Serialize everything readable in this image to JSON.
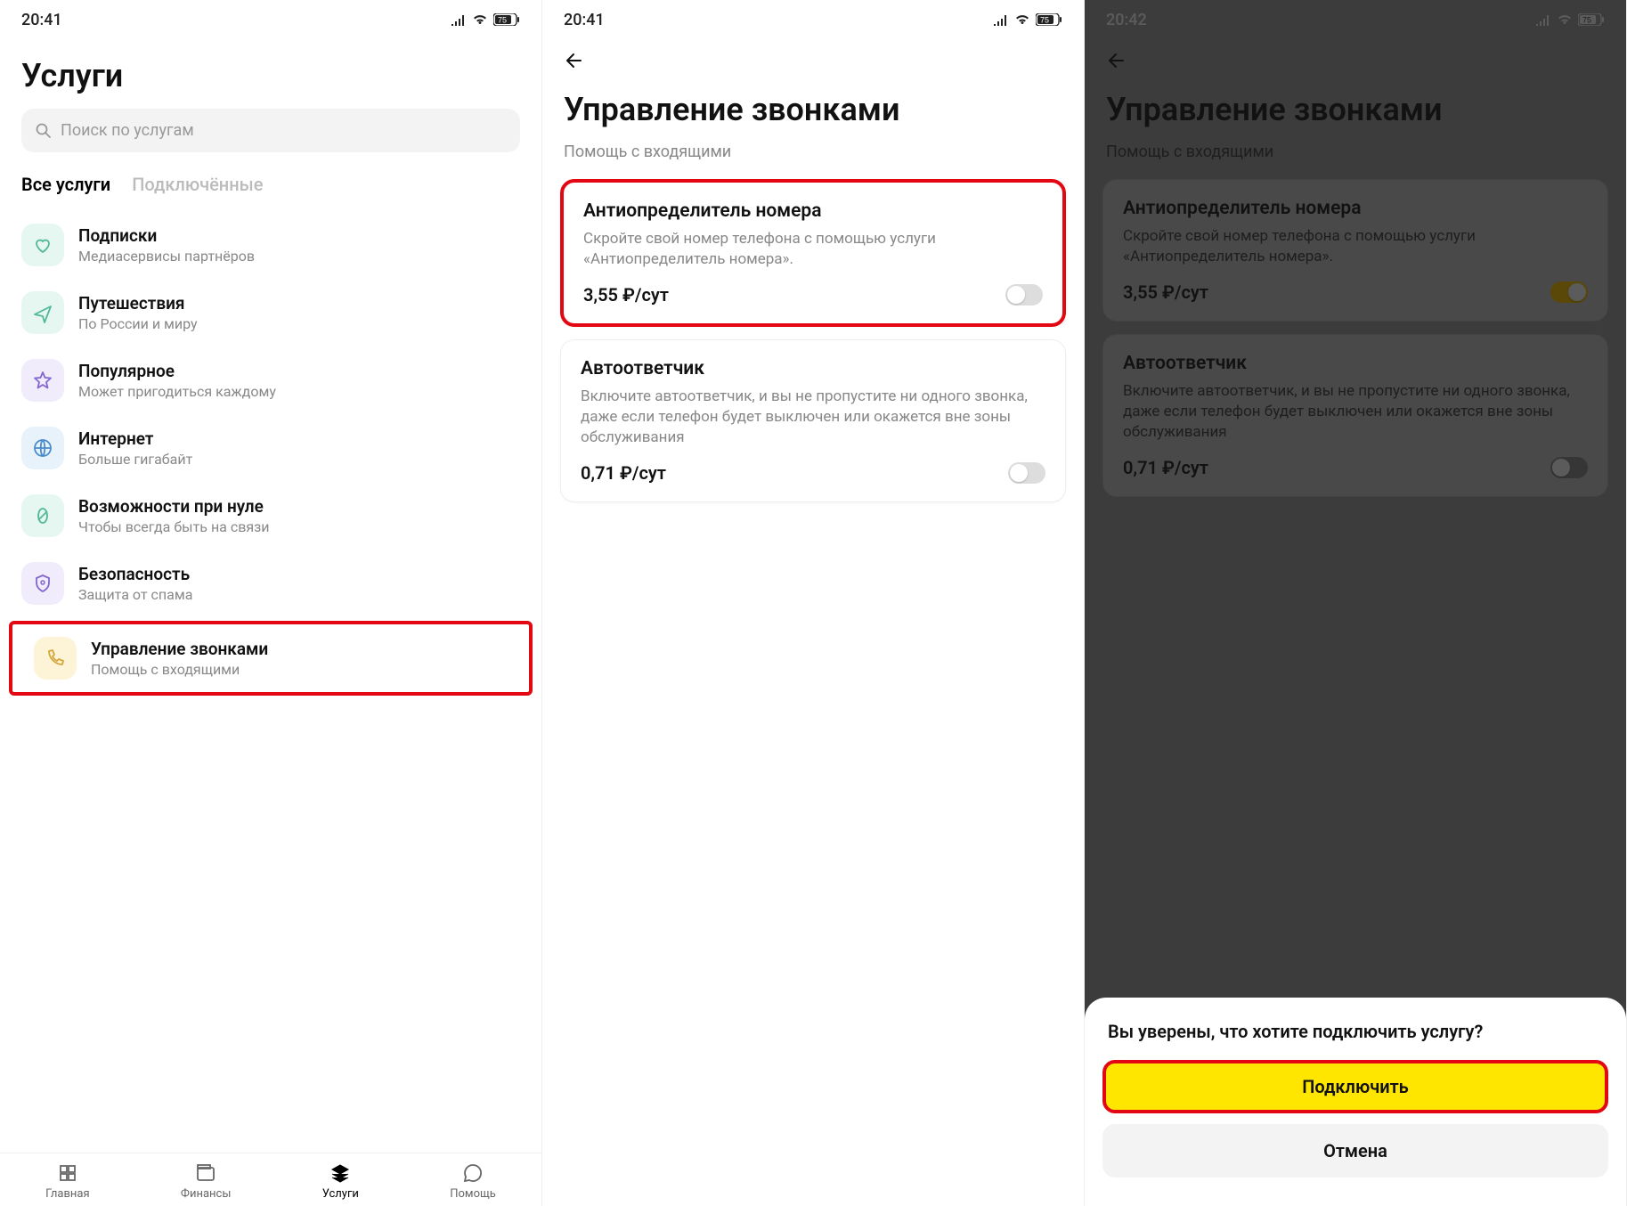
{
  "status": {
    "time1": "20:41",
    "time2": "20:41",
    "time3": "20:42",
    "battery": "75"
  },
  "screen1": {
    "title": "Услуги",
    "search_placeholder": "Поиск по услугам",
    "tab_all": "Все услуги",
    "tab_connected": "Подключённые",
    "items": [
      {
        "title": "Подписки",
        "sub": "Медиасервисы партнёров"
      },
      {
        "title": "Путешествия",
        "sub": "По России и миру"
      },
      {
        "title": "Популярное",
        "sub": "Может пригодиться каждому"
      },
      {
        "title": "Интернет",
        "sub": "Больше гигабайт"
      },
      {
        "title": "Возможности при нуле",
        "sub": "Чтобы всегда быть на связи"
      },
      {
        "title": "Безопасность",
        "sub": "Защита от спама"
      },
      {
        "title": "Управление звонками",
        "sub": "Помощь с входящими"
      }
    ],
    "nav": {
      "home": "Главная",
      "finance": "Финансы",
      "services": "Услуги",
      "help": "Помощь"
    }
  },
  "screen2": {
    "title": "Управление звонками",
    "subtitle": "Помощь с входящими",
    "card1": {
      "title": "Антиопределитель номера",
      "desc": "Скройте свой номер телефона с помощью услуги «Антиопределитель номера».",
      "price": "3,55 ₽/сут"
    },
    "card2": {
      "title": "Автоответчик",
      "desc": "Включите автоответчик, и вы не пропустите ни одного звонка, даже если телефон будет выключен или окажется вне зоны обслуживания",
      "price": "0,71 ₽/сут"
    }
  },
  "screen3": {
    "sheet_title": "Вы уверены, что хотите подключить услугу?",
    "btn_confirm": "Подключить",
    "btn_cancel": "Отмена"
  }
}
